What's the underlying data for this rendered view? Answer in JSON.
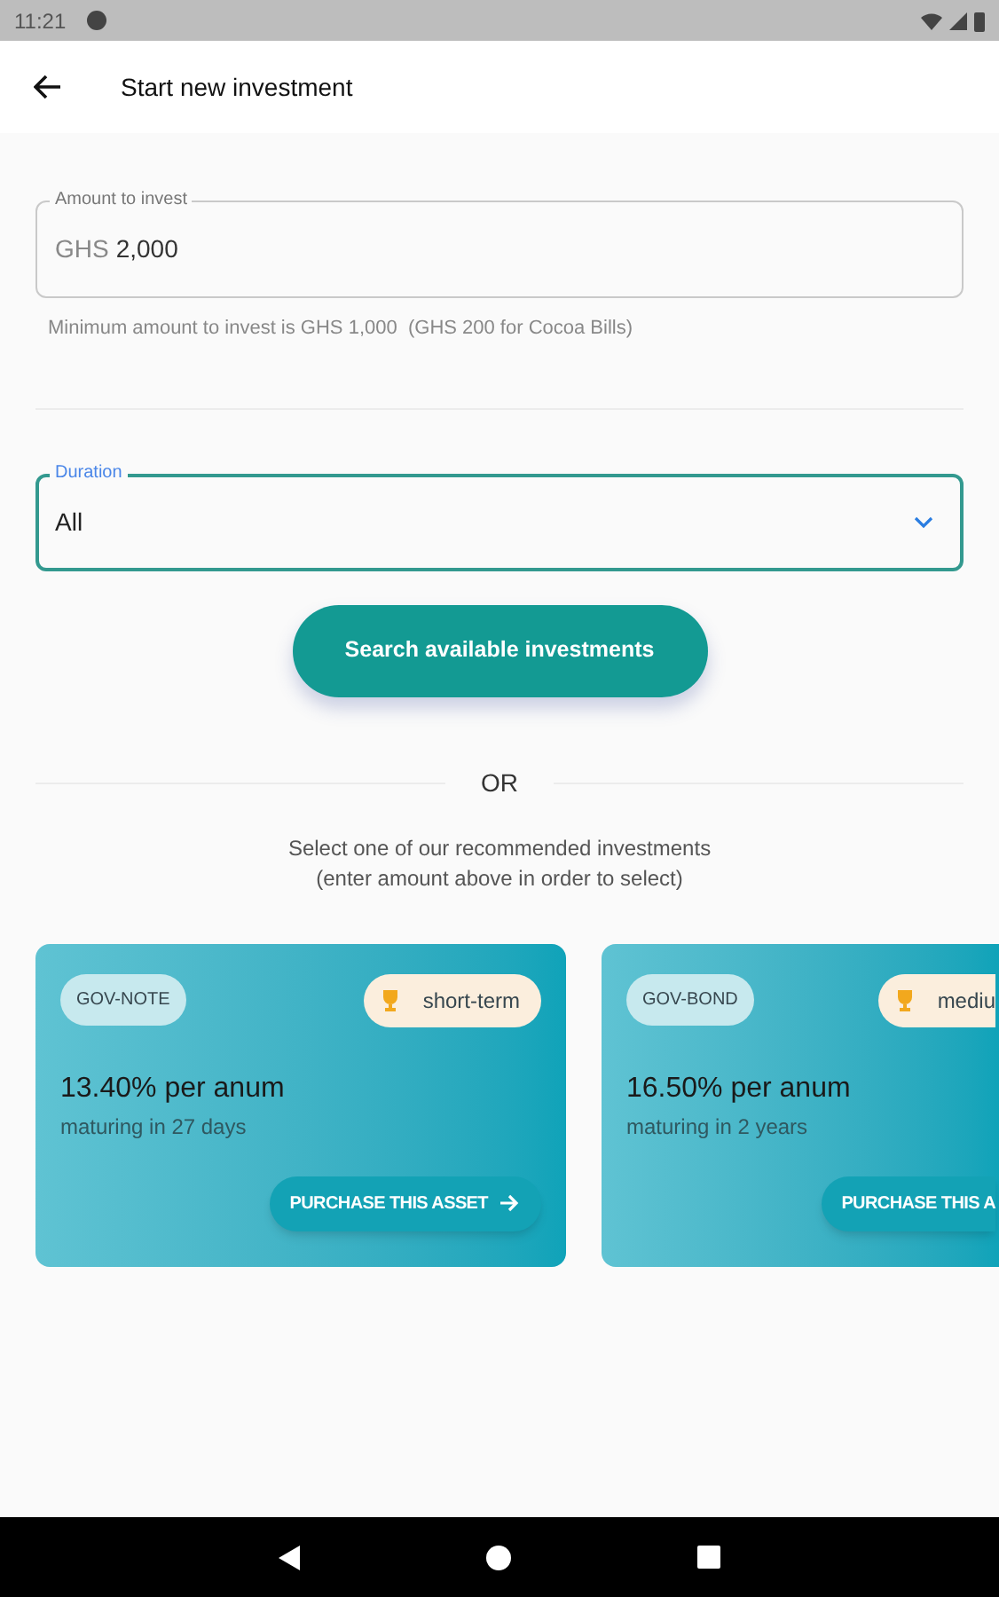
{
  "status_bar": {
    "time": "11:21"
  },
  "app_bar": {
    "title": "Start new investment"
  },
  "amount_field": {
    "label": "Amount to invest",
    "prefix": "GHS",
    "value": "2,000",
    "helper": "Minimum amount to invest is GHS 1,000  (GHS 200 for Cocoa Bills)"
  },
  "duration_field": {
    "label": "Duration",
    "value": "All"
  },
  "search_button": "Search available investments",
  "divider_text": "OR",
  "recommend_text": [
    "Select one of our recommended investments",
    "(enter amount above in order to select)"
  ],
  "investments": [
    {
      "type": "GOV-NOTE",
      "term": "short-term",
      "rate": "13.40% per anum",
      "maturity": "maturing in 27 days",
      "action": "PURCHASE THIS ASSET",
      "cut_off": false
    },
    {
      "type": "GOV-BOND",
      "term": "mediu",
      "rate": "16.50% per anum",
      "maturity": "maturing in 2 years",
      "action": "PURCHASE THIS A",
      "cut_off": true
    }
  ]
}
